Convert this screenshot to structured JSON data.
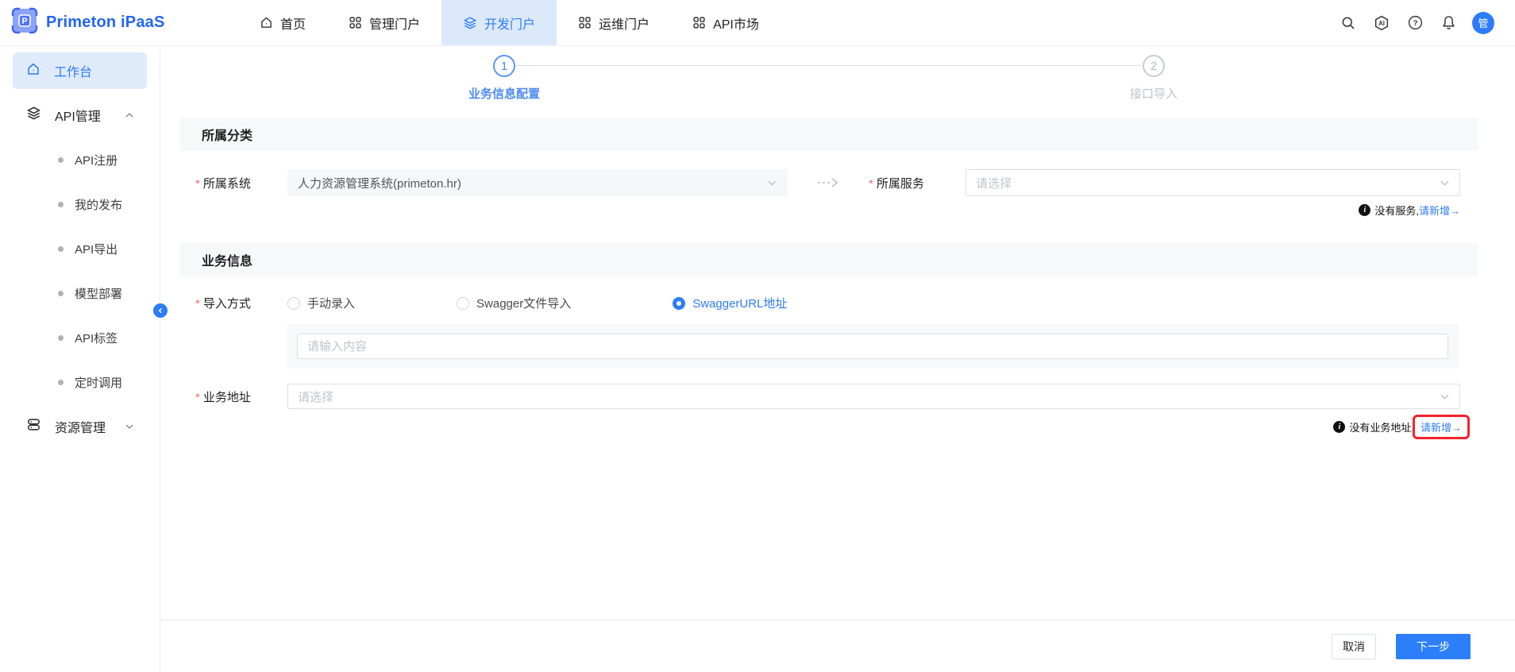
{
  "colors": {
    "primary": "#2d7cf7",
    "brand_blue": "#2366f2",
    "active_nav_bg": "#dbe9fb",
    "highlight_red": "#f5222d",
    "section_header_bg": "#f7f8fa"
  },
  "navbar": {
    "brand": "Primeton iPaaS",
    "items": [
      {
        "label": "首页",
        "icon": "home-icon"
      },
      {
        "label": "管理门户",
        "icon": "grid-icon"
      },
      {
        "label": "开发门户",
        "icon": "layers-icon",
        "active": true
      },
      {
        "label": "运维门户",
        "icon": "grid-icon"
      },
      {
        "label": "API市场",
        "icon": "grid-icon"
      }
    ],
    "right_icons": [
      "search-icon",
      "ai-icon",
      "help-icon",
      "bell-icon"
    ],
    "avatar": "管"
  },
  "sidebar": {
    "items": [
      {
        "label": "工作台",
        "icon": "home-icon",
        "active": true
      },
      {
        "label": "API管理",
        "icon": "layers-icon",
        "expanded": true,
        "children": [
          "API注册",
          "我的发布",
          "API导出",
          "模型部署",
          "API标签",
          "定时调用"
        ]
      },
      {
        "label": "资源管理",
        "icon": "database-icon",
        "expanded": false
      }
    ]
  },
  "stepper": {
    "steps": [
      {
        "num": "1",
        "label": "业务信息配置",
        "active": true
      },
      {
        "num": "2",
        "label": "接口导入",
        "active": false
      }
    ]
  },
  "form": {
    "section1": {
      "title": "所属分类",
      "system_label": "所属系统",
      "system_value": "人力资源管理系统(primeton.hr)",
      "service_label": "所属服务",
      "service_placeholder": "请选择",
      "service_hint": "没有服务,",
      "service_hint_link": "请新增→"
    },
    "section2": {
      "title": "业务信息",
      "import_label": "导入方式",
      "radios": [
        "手动录入",
        "Swagger文件导入",
        "SwaggerURL地址"
      ],
      "selected_radio": "SwaggerURL地址",
      "url_placeholder": "请输入内容",
      "address_label": "业务地址",
      "address_placeholder": "请选择",
      "address_hint": "没有业务地址,",
      "address_hint_link": "请新增→"
    }
  },
  "footer": {
    "cancel": "取消",
    "next": "下一步"
  }
}
